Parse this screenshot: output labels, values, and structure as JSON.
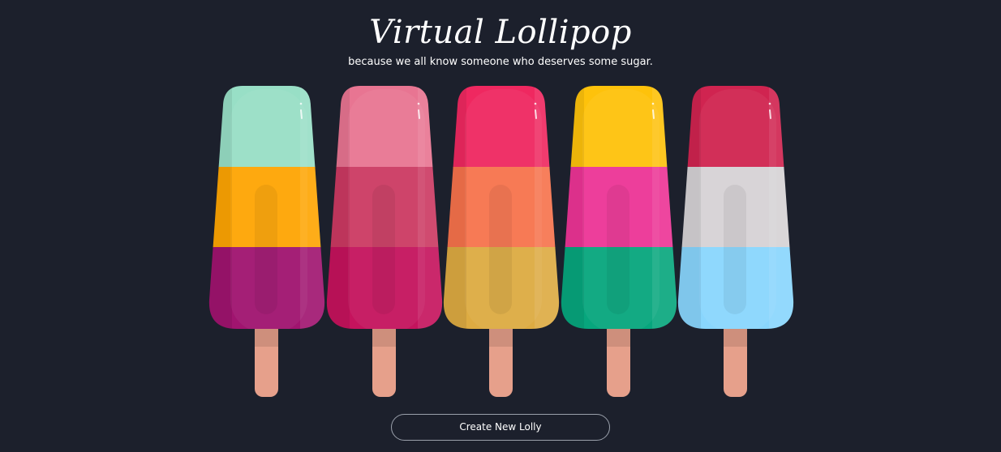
{
  "header": {
    "title": "Virtual Lollipop",
    "subtitle": "because we all know someone who deserves some sugar."
  },
  "lollies": [
    {
      "top": "#98dfc6",
      "middle": "#fea503",
      "bottom": "#a0146f"
    },
    {
      "top": "#e87592",
      "middle": "#cc3a62",
      "bottom": "#c5135d"
    },
    {
      "top": "#ef2860",
      "middle": "#f7734c",
      "bottom": "#ddab42"
    },
    {
      "top": "#fec20b",
      "middle": "#ed3496",
      "bottom": "#07a67d"
    },
    {
      "top": "#d02450",
      "middle": "#d6d2d5",
      "bottom": "#89d6fd"
    }
  ],
  "colors": {
    "background": "#1c202c",
    "stick": "#e6a08b",
    "button_border": "#9aa0ab"
  },
  "actions": {
    "create_label": "Create New Lolly"
  }
}
